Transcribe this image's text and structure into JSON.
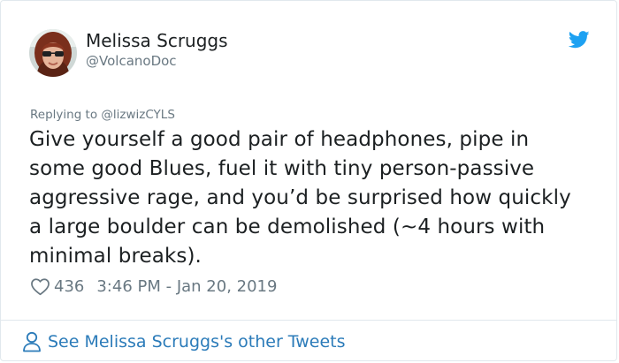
{
  "tweet": {
    "author": {
      "display_name": "Melissa Scruggs",
      "handle": "@VolcanoDoc"
    },
    "replying_to": "Replying to @lizwizCYLS",
    "text_lines": [
      "Give yourself a good pair of headphones, pipe in",
      "some good Blues, fuel it with tiny person-passive",
      "aggressive rage, and you’d be surprised how quickly",
      "a large boulder can be demolished (~4 hours with",
      "minimal breaks)."
    ],
    "like_count": "436",
    "timestamp": "3:46 PM - Jan 20, 2019",
    "see_more_label": "See Melissa Scruggs's other Tweets"
  },
  "icons": {
    "brand": "twitter-bird-icon",
    "like": "heart-icon",
    "profile": "person-icon"
  },
  "colors": {
    "text": "#1c2022",
    "muted": "#697882",
    "link": "#2b7bb9",
    "brand": "#1da1f2",
    "border": "#e1e8ed"
  }
}
